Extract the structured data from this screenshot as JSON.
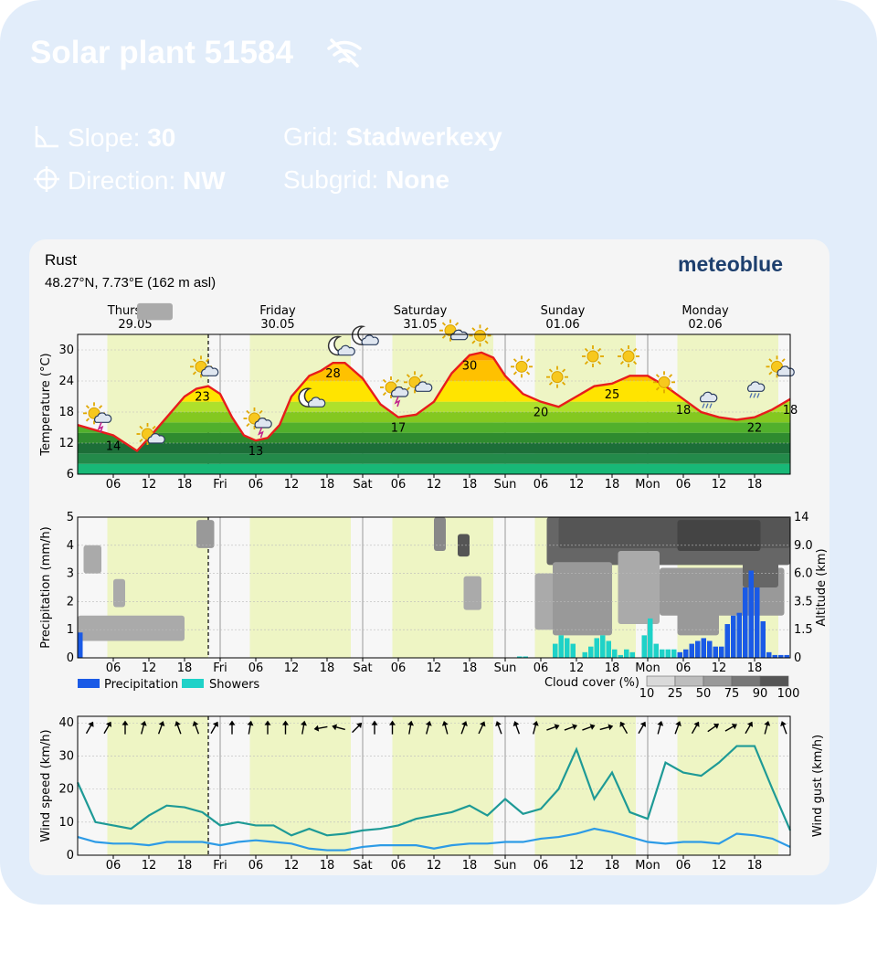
{
  "header": {
    "title": "Solar plant 51584",
    "status_icon": "wifi-off-icon",
    "slope_label": "Slope:",
    "slope_value": "30",
    "grid_label": "Grid:",
    "grid_value": "Stadwerkexy",
    "direction_label": "Direction:",
    "direction_value": "NW",
    "subgrid_label": "Subgrid:",
    "subgrid_value": "None"
  },
  "colors": {
    "card": "#e2edfa",
    "widget": "#f5f5f5",
    "day": "#eef5c4",
    "temp_line": "#e81c1c",
    "precip": "#1a5ae6",
    "showers": "#1ed2c8",
    "wind": "#2d9be6",
    "gust": "#1e9a96",
    "accent_weekend": "#cc0000"
  },
  "meteogram": {
    "location": "Rust",
    "coords": "48.27°N, 7.73°E (162 m asl)",
    "brand": "meteoblue",
    "days": [
      {
        "name": "Thursday",
        "date": "29.05",
        "weekend": false
      },
      {
        "name": "Friday",
        "date": "30.05",
        "weekend": false
      },
      {
        "name": "Saturday",
        "date": "31.05",
        "weekend": true
      },
      {
        "name": "Sunday",
        "date": "01.06",
        "weekend": true
      },
      {
        "name": "Monday",
        "date": "02.06",
        "weekend": false
      }
    ],
    "x_ticks": [
      "06",
      "12",
      "18",
      "Fri",
      "06",
      "12",
      "18",
      "Sat",
      "06",
      "12",
      "18",
      "Sun",
      "06",
      "12",
      "18",
      "Mon",
      "06",
      "12",
      "18"
    ],
    "legend_precip": "Precipitation",
    "legend_showers": "Showers",
    "cloud_label": "Cloud cover (%)",
    "cloud_levels": [
      "10",
      "25",
      "50",
      "75",
      "90",
      "100"
    ],
    "wind_arrow_icon": "wind-direction-arrow-icon",
    "weather_icons": [
      "moon-cloud-icon",
      "sun-cloud-icon",
      "sun-icon",
      "thunder-icon",
      "rain-cloud-icon"
    ]
  },
  "chart_data": [
    {
      "type": "line",
      "ylabel": "Temperature (°C)",
      "ylim": [
        6,
        33
      ],
      "yticks": [
        6,
        12,
        18,
        24,
        30
      ],
      "x_unit": "hours from Thursday 00:00",
      "x": [
        0,
        3,
        6,
        8,
        10,
        12,
        15,
        18,
        20,
        22,
        24,
        26,
        28,
        30,
        32,
        34,
        36,
        39,
        41,
        43,
        45,
        48,
        51,
        54,
        57,
        60,
        63,
        66,
        68,
        70,
        72,
        75,
        78,
        81,
        84,
        87,
        90,
        93,
        96,
        99,
        102,
        105,
        108,
        111,
        114,
        117,
        120
      ],
      "series": [
        {
          "name": "Temperature",
          "values": [
            15.5,
            14.5,
            13.5,
            12,
            10.5,
            13,
            17,
            21,
            22.5,
            23,
            21.5,
            17,
            13.5,
            12.5,
            13,
            15.5,
            21,
            25,
            26,
            27.5,
            27.5,
            24.5,
            19.5,
            17,
            17.5,
            20,
            25.5,
            29,
            29.5,
            28.5,
            25,
            21.5,
            20,
            19,
            21,
            23,
            23.5,
            25,
            25,
            23,
            20.5,
            18,
            17,
            16.5,
            17,
            18.5,
            20.5,
            22,
            21.5,
            18.5
          ]
        }
      ],
      "labels": [
        {
          "x": 6,
          "t": "14"
        },
        {
          "x": 21,
          "t": "23"
        },
        {
          "x": 30,
          "t": "13"
        },
        {
          "x": 43,
          "t": "28"
        },
        {
          "x": 54,
          "t": "17"
        },
        {
          "x": 66,
          "t": "30"
        },
        {
          "x": 78,
          "t": "20"
        },
        {
          "x": 90,
          "t": "25"
        },
        {
          "x": 102,
          "t": "18"
        },
        {
          "x": 114,
          "t": "22"
        },
        {
          "x": 120,
          "t": "18"
        }
      ]
    },
    {
      "type": "bar",
      "ylabel": "Precipitation (mm/h)",
      "ylabel2": "Altitude (km)",
      "ylim": [
        0,
        5
      ],
      "yticks": [
        0,
        1,
        2,
        3,
        4,
        5
      ],
      "y2ticks": [
        "0",
        "1.5",
        "3.5",
        "6.0",
        "9.0",
        "14"
      ],
      "series": [
        {
          "name": "Precipitation",
          "x": [
            0,
            98,
            99,
            100,
            101,
            102,
            103,
            104,
            105,
            106,
            107,
            108,
            109,
            110,
            111,
            112,
            113,
            114,
            115,
            116,
            117,
            118,
            119
          ],
          "values": [
            0.9,
            0.2,
            0.1,
            0.2,
            0.2,
            0.3,
            0.5,
            0.6,
            0.7,
            0.6,
            0.4,
            0.4,
            1.2,
            1.5,
            1.6,
            2.5,
            3.1,
            2.5,
            1.3,
            0.2,
            0.1,
            0.1,
            0.1
          ]
        },
        {
          "name": "Showers",
          "x": [
            74,
            75,
            80,
            81,
            82,
            83,
            85,
            86,
            87,
            88,
            89,
            90,
            91,
            92,
            93,
            95,
            96,
            97,
            98,
            99,
            100
          ],
          "values": [
            0.05,
            0.05,
            0.5,
            0.8,
            0.7,
            0.5,
            0.2,
            0.4,
            0.7,
            0.8,
            0.6,
            0.3,
            0.1,
            0.3,
            0.2,
            0.8,
            1.4,
            0.5,
            0.3,
            0.3,
            0.3
          ]
        }
      ]
    },
    {
      "type": "line",
      "ylabel": "Wind speed (km/h)",
      "ylabel2": "Wind gust (km/h)",
      "ylim": [
        0,
        42
      ],
      "yticks": [
        0,
        10,
        20,
        30,
        40
      ],
      "x": [
        0,
        3,
        6,
        9,
        12,
        15,
        18,
        21,
        24,
        27,
        30,
        33,
        36,
        39,
        42,
        45,
        48,
        51,
        54,
        57,
        60,
        63,
        66,
        69,
        72,
        75,
        78,
        81,
        84,
        87,
        90,
        93,
        96,
        99,
        102,
        105,
        108,
        111,
        114,
        117,
        120
      ],
      "series": [
        {
          "name": "Wind speed",
          "values": [
            5.5,
            4,
            3.5,
            3.5,
            3,
            4,
            4,
            4,
            3,
            4,
            4.5,
            4,
            3.5,
            2,
            1.5,
            1.5,
            2.5,
            3,
            3,
            3,
            2,
            3,
            3.5,
            3.5,
            4,
            4,
            5,
            5.5,
            6.5,
            8,
            7,
            5.5,
            4,
            3.5,
            4,
            4,
            3.5,
            6.5,
            6,
            5,
            2.5
          ]
        },
        {
          "name": "Wind gust",
          "values": [
            22,
            10,
            9,
            8,
            12,
            15,
            14.5,
            13,
            9,
            10,
            9,
            9,
            6,
            8,
            6,
            6.5,
            7.5,
            8,
            9,
            11,
            12,
            13,
            15,
            12,
            17,
            12.5,
            14,
            20,
            32,
            17,
            25,
            13,
            11,
            28,
            25,
            24,
            28,
            33,
            33,
            20,
            7.5
          ]
        }
      ],
      "wind_directions_deg": [
        30,
        30,
        0,
        15,
        20,
        -20,
        -20,
        30,
        0,
        10,
        0,
        0,
        10,
        -100,
        -75,
        45,
        0,
        0,
        10,
        15,
        -15,
        20,
        25,
        -20,
        -20,
        15,
        70,
        70,
        70,
        75,
        -30,
        30,
        15,
        20,
        30,
        55,
        60,
        30,
        15,
        -20
      ]
    }
  ]
}
